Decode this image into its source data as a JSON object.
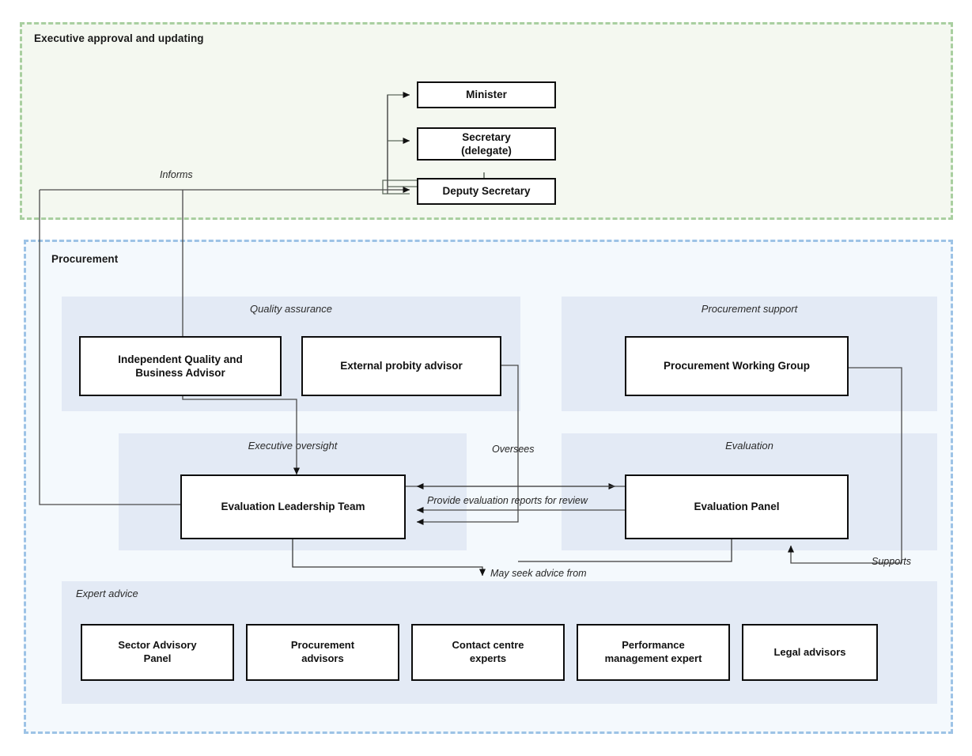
{
  "diagram": {
    "title_visible": false,
    "zones": [
      {
        "id": "executive",
        "label": "Executive approval and updating",
        "accent": "#a9cfa0",
        "fill": "#f4f8f0"
      },
      {
        "id": "procurement",
        "label": "Procurement",
        "accent": "#9dc3e6",
        "fill": "#f4f9fd"
      }
    ],
    "bands": [
      {
        "id": "quality-assurance",
        "label": "Quality assurance",
        "fill": "#e3eaf5",
        "align": "center"
      },
      {
        "id": "procurement-support",
        "label": "Procurement support",
        "fill": "#e3eaf5",
        "align": "center"
      },
      {
        "id": "executive-oversight",
        "label": "Executive oversight",
        "fill": "#e3eaf5",
        "align": "center"
      },
      {
        "id": "evaluation",
        "label": "Evaluation",
        "fill": "#e3eaf5",
        "align": "center"
      },
      {
        "id": "expert-advice",
        "label": "Expert advice",
        "fill": "#e3eaf5",
        "align": "left"
      }
    ],
    "nodes": [
      {
        "id": "minister",
        "label": "Minister"
      },
      {
        "id": "secretary",
        "label": "Secretary\n(delegate)",
        "line1": "Secretary",
        "line2": "(delegate)"
      },
      {
        "id": "deputy-secretary",
        "label": "Deputy Secretary"
      },
      {
        "id": "independent-quality-business-advisor",
        "line1": "Independent Quality and",
        "line2": "Business Advisor"
      },
      {
        "id": "external-probity-advisor",
        "label": "External probity advisor"
      },
      {
        "id": "procurement-working-group",
        "label": "Procurement Working Group"
      },
      {
        "id": "evaluation-leadership-team",
        "label": "Evaluation Leadership Team"
      },
      {
        "id": "evaluation-panel",
        "label": "Evaluation Panel"
      },
      {
        "id": "sector-advisory-panel",
        "line1": "Sector Advisory",
        "line2": "Panel"
      },
      {
        "id": "procurement-advisors",
        "line1": "Procurement",
        "line2": "advisors"
      },
      {
        "id": "contact-centre-experts",
        "line1": "Contact centre",
        "line2": "experts"
      },
      {
        "id": "performance-management-expert",
        "line1": "Performance",
        "line2": "management expert"
      },
      {
        "id": "legal-advisors",
        "label": "Legal advisors"
      }
    ],
    "edge_labels": [
      {
        "id": "informs",
        "text": "Informs"
      },
      {
        "id": "oversees",
        "text": "Oversees"
      },
      {
        "id": "provide-evaluation-reports",
        "text": "Provide evaluation reports for review"
      },
      {
        "id": "may-seek-advice-from",
        "text": "May seek advice from"
      },
      {
        "id": "supports",
        "text": "Supports"
      }
    ],
    "colors": {
      "executive_border": "#a9cfa0",
      "executive_fill": "#f4f8f0",
      "procurement_border": "#9dc3e6",
      "procurement_fill": "#f4f9fd",
      "band_fill": "#e3eaf5",
      "node_border": "#0d0d0d",
      "node_fill": "#ffffff",
      "connector_dark": "#1a1a1a",
      "connector_grey": "#6b6b6b"
    }
  }
}
